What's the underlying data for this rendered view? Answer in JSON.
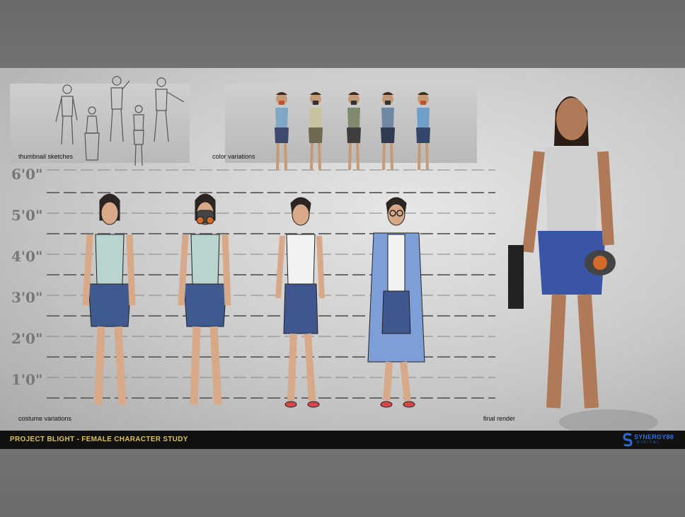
{
  "labels": {
    "thumbnail": "thumbnail sketches",
    "color": "color variations",
    "costume": "costume variations",
    "final": "final render"
  },
  "height_marks": [
    "6'0\"",
    "5'0\"",
    "4'0\"",
    "3'0\"",
    "2'0\"",
    "1'0\""
  ],
  "footer": {
    "title": "PROJECT BLIGHT - FEMALE CHARACTER STUDY",
    "logo_word": "SYNERGY88",
    "logo_sub": "DIGITAL"
  },
  "colors": {
    "footer_title": "#d8c35a",
    "logo": "#2a6fd6"
  },
  "color_variation_shirts": [
    "#7fa7c7",
    "#c9c2a0",
    "#7f8a6e",
    "#6f88a3",
    "#6f9ec7"
  ]
}
